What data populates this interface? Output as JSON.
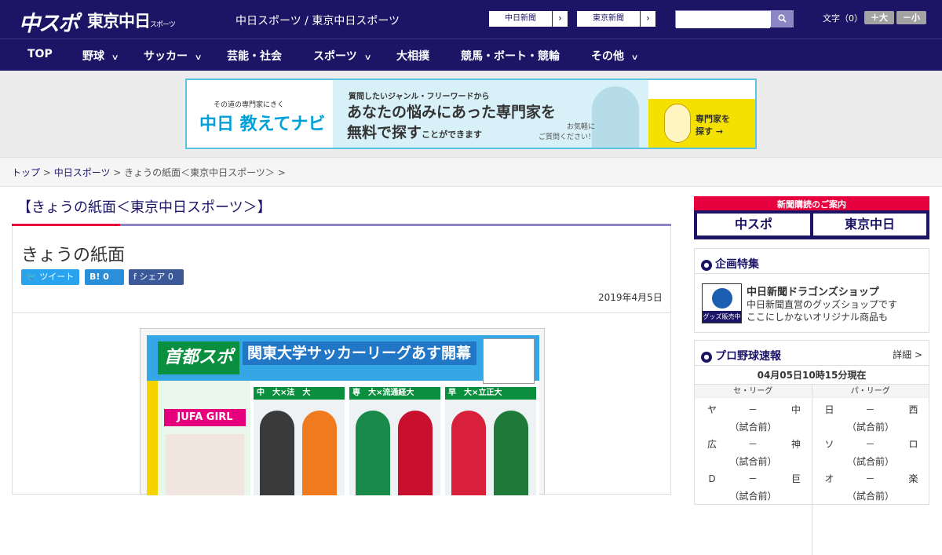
{
  "header": {
    "logo_chuspo": "中スポ",
    "logo_tokyo": "東京中日",
    "logo_tokyo_small": "スポーツ",
    "site_title": "中日スポーツ / 東京中日スポーツ",
    "link_chunichi": "中日新聞",
    "link_tokyo": "東京新聞",
    "chevron": "›",
    "search_placeholder": "",
    "search_icon": "search-icon",
    "font_size_label": "文字（0）",
    "font_larger": "＋大",
    "font_smaller": "－小"
  },
  "nav": {
    "items": [
      {
        "label": "TOP",
        "dropdown": false
      },
      {
        "label": "野球",
        "dropdown": true
      },
      {
        "label": "サッカー",
        "dropdown": true
      },
      {
        "label": "芸能・社会",
        "dropdown": false
      },
      {
        "label": "スポーツ",
        "dropdown": true
      },
      {
        "label": "大相撲",
        "dropdown": false
      },
      {
        "label": "競馬・ボート・競輪",
        "dropdown": false
      },
      {
        "label": "その他",
        "dropdown": true
      }
    ],
    "dropdown_glyph": "∨"
  },
  "ad": {
    "small": "その道の専門家にきく",
    "brand": "中日 教えてナビ",
    "question": "質問したいジャンル・フリーワードから",
    "headline1": "あなたの悩みにあった専門家を",
    "headline2": "無料で探す",
    "headline2_tail": "ことができます",
    "note1": "お気軽に",
    "note2": "ご質問ください！",
    "cta1": "専門家を",
    "cta2": "探す →"
  },
  "breadcrumb": {
    "home": "トップ",
    "sep": " > ",
    "section": "中日スポーツ",
    "current": "きょうの紙面＜東京中日スポーツ＞ >"
  },
  "page": {
    "heading": "【きょうの紙面＜東京中日スポーツ＞】",
    "article_title": "きょうの紙面",
    "tweet": "ツイート",
    "hatena": "B! 0",
    "facebook": "シェア 0",
    "date": "2019年4月5日"
  },
  "paper": {
    "logo": "首都スポ",
    "headline": "関東大学サッカーリーグあす開幕",
    "jufa": "JUFA GIRL",
    "teams": [
      {
        "tag": "中　大×法　大"
      },
      {
        "tag": "専　大×流通経大"
      },
      {
        "tag": "早　大×立正大"
      }
    ]
  },
  "sidebar": {
    "subscribe_label": "新聞購読のご案内",
    "sub_chuspo": "中スポ",
    "sub_tokyo": "東京中日",
    "feature_title": "企画特集",
    "shop_label": "グッズ販売中",
    "shop_title": "中日新聞ドラゴンズショップ",
    "shop_desc1": "中日新聞直営のグッズショップです",
    "shop_desc2": "ここにしかないオリジナル商品も",
    "baseball_title": "プロ野球速報",
    "baseball_more": "詳細 >",
    "baseball_date": "04月05日10時15分現在",
    "central": "セ・リーグ",
    "pacific": "パ・リーグ",
    "games_central": [
      {
        "home": "ヤ",
        "dash": "－",
        "away": "中",
        "status": "（試合前）"
      },
      {
        "home": "広",
        "dash": "－",
        "away": "神",
        "status": "（試合前）"
      },
      {
        "home": "Ｄ",
        "dash": "－",
        "away": "巨",
        "status": "（試合前）"
      }
    ],
    "games_pacific": [
      {
        "home": "日",
        "dash": "－",
        "away": "西",
        "status": "（試合前）"
      },
      {
        "home": "ソ",
        "dash": "－",
        "away": "ロ",
        "status": "（試合前）"
      },
      {
        "home": "オ",
        "dash": "－",
        "away": "楽",
        "status": "（試合前）"
      }
    ]
  }
}
